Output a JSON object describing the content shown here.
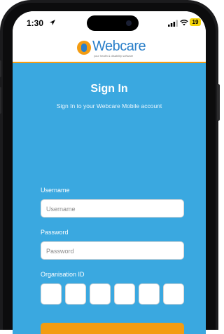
{
  "status_bar": {
    "time": "1:30",
    "battery": "19"
  },
  "brand": {
    "logo_text": "Webcare",
    "tagline": "your health & disability software"
  },
  "signin": {
    "title": "Sign In",
    "subtitle": "Sign In to your Webcare Mobile account",
    "username_label": "Username",
    "username_placeholder": "Username",
    "password_label": "Password",
    "password_placeholder": "Password",
    "org_label": "Organisation ID",
    "org_boxes": [
      "",
      "",
      "",
      "",
      "",
      ""
    ]
  },
  "colors": {
    "primary_blue": "#3aa8e0",
    "accent_orange": "#f39c12",
    "logo_blue": "#2a7fc9"
  }
}
